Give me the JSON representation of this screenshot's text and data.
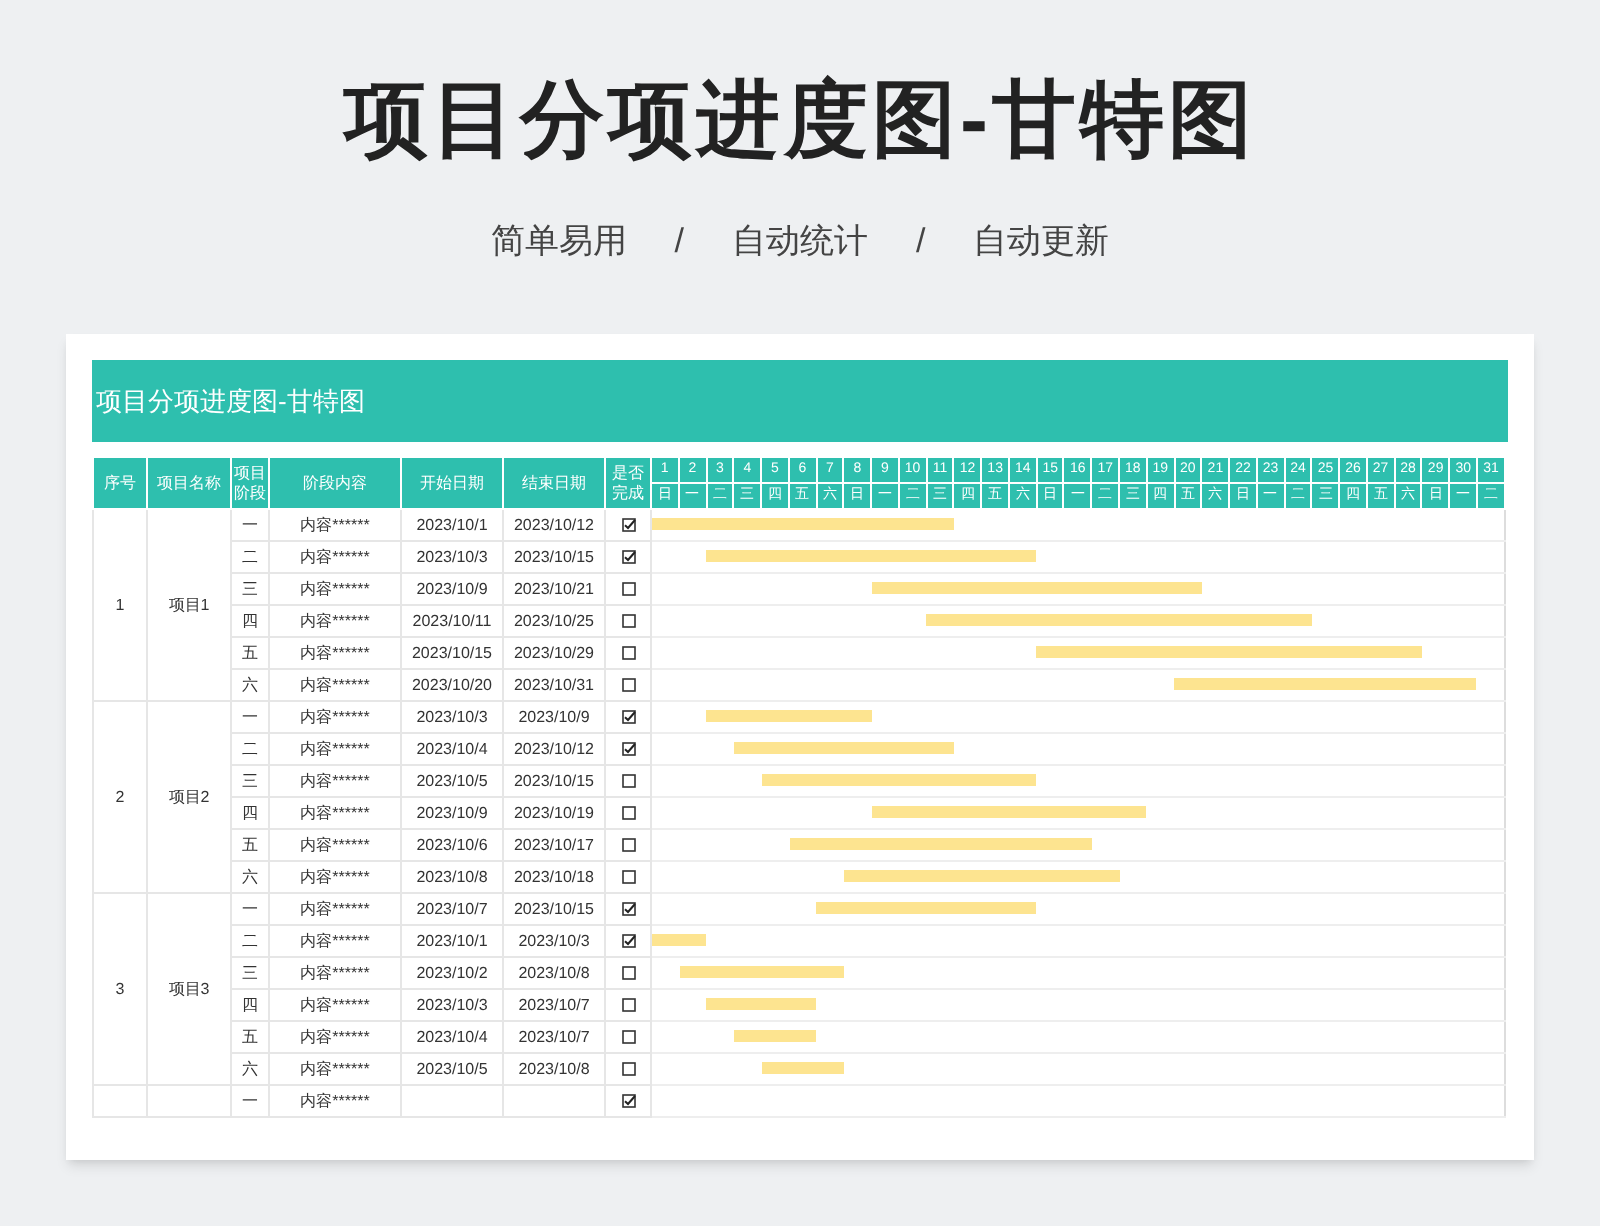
{
  "title": "项目分项进度图-甘特图",
  "subtitle": [
    "简单易用",
    "/",
    "自动统计",
    "/",
    "自动更新"
  ],
  "sheet": {
    "title": "项目分项进度图-甘特图",
    "columns": [
      "序号",
      "项目名称",
      "项目阶段",
      "阶段内容",
      "开始日期",
      "结束日期",
      "是否完成"
    ],
    "days": [
      {
        "day": "1",
        "weekday": "日"
      },
      {
        "day": "2",
        "weekday": "一"
      },
      {
        "day": "3",
        "weekday": "二"
      },
      {
        "day": "4",
        "weekday": "三"
      },
      {
        "day": "5",
        "weekday": "四"
      },
      {
        "day": "6",
        "weekday": "五"
      },
      {
        "day": "7",
        "weekday": "六"
      },
      {
        "day": "8",
        "weekday": "日"
      },
      {
        "day": "9",
        "weekday": "一"
      },
      {
        "day": "10",
        "weekday": "二"
      },
      {
        "day": "11",
        "weekday": "三"
      },
      {
        "day": "12",
        "weekday": "四"
      },
      {
        "day": "13",
        "weekday": "五"
      },
      {
        "day": "14",
        "weekday": "六"
      },
      {
        "day": "15",
        "weekday": "日"
      },
      {
        "day": "16",
        "weekday": "一"
      },
      {
        "day": "17",
        "weekday": "二"
      },
      {
        "day": "18",
        "weekday": "三"
      },
      {
        "day": "19",
        "weekday": "四"
      },
      {
        "day": "20",
        "weekday": "五"
      },
      {
        "day": "21",
        "weekday": "六"
      },
      {
        "day": "22",
        "weekday": "日"
      },
      {
        "day": "23",
        "weekday": "一"
      },
      {
        "day": "24",
        "weekday": "二"
      },
      {
        "day": "25",
        "weekday": "三"
      },
      {
        "day": "26",
        "weekday": "四"
      },
      {
        "day": "27",
        "weekday": "五"
      },
      {
        "day": "28",
        "weekday": "六"
      },
      {
        "day": "29",
        "weekday": "日"
      },
      {
        "day": "30",
        "weekday": "一"
      },
      {
        "day": "31",
        "weekday": "二"
      }
    ],
    "groups": [
      {
        "no": "1",
        "name": "项目1",
        "stages": [
          {
            "stage": "一",
            "content": "内容******",
            "start": "2023/10/1",
            "end": "2023/10/12",
            "done": true
          },
          {
            "stage": "二",
            "content": "内容******",
            "start": "2023/10/3",
            "end": "2023/10/15",
            "done": true
          },
          {
            "stage": "三",
            "content": "内容******",
            "start": "2023/10/9",
            "end": "2023/10/21",
            "done": false
          },
          {
            "stage": "四",
            "content": "内容******",
            "start": "2023/10/11",
            "end": "2023/10/25",
            "done": false
          },
          {
            "stage": "五",
            "content": "内容******",
            "start": "2023/10/15",
            "end": "2023/10/29",
            "done": false
          },
          {
            "stage": "六",
            "content": "内容******",
            "start": "2023/10/20",
            "end": "2023/10/31",
            "done": false
          }
        ]
      },
      {
        "no": "2",
        "name": "项目2",
        "stages": [
          {
            "stage": "一",
            "content": "内容******",
            "start": "2023/10/3",
            "end": "2023/10/9",
            "done": true
          },
          {
            "stage": "二",
            "content": "内容******",
            "start": "2023/10/4",
            "end": "2023/10/12",
            "done": true
          },
          {
            "stage": "三",
            "content": "内容******",
            "start": "2023/10/5",
            "end": "2023/10/15",
            "done": false
          },
          {
            "stage": "四",
            "content": "内容******",
            "start": "2023/10/9",
            "end": "2023/10/19",
            "done": false
          },
          {
            "stage": "五",
            "content": "内容******",
            "start": "2023/10/6",
            "end": "2023/10/17",
            "done": false
          },
          {
            "stage": "六",
            "content": "内容******",
            "start": "2023/10/8",
            "end": "2023/10/18",
            "done": false
          }
        ]
      },
      {
        "no": "3",
        "name": "项目3",
        "stages": [
          {
            "stage": "一",
            "content": "内容******",
            "start": "2023/10/7",
            "end": "2023/10/15",
            "done": true
          },
          {
            "stage": "二",
            "content": "内容******",
            "start": "2023/10/1",
            "end": "2023/10/3",
            "done": true
          },
          {
            "stage": "三",
            "content": "内容******",
            "start": "2023/10/2",
            "end": "2023/10/8",
            "done": false
          },
          {
            "stage": "四",
            "content": "内容******",
            "start": "2023/10/3",
            "end": "2023/10/7",
            "done": false
          },
          {
            "stage": "五",
            "content": "内容******",
            "start": "2023/10/4",
            "end": "2023/10/7",
            "done": false
          },
          {
            "stage": "六",
            "content": "内容******",
            "start": "2023/10/5",
            "end": "2023/10/8",
            "done": false
          }
        ]
      },
      {
        "stages": [
          {
            "stage": "一",
            "content": "内容******",
            "done": true
          }
        ]
      }
    ]
  }
}
